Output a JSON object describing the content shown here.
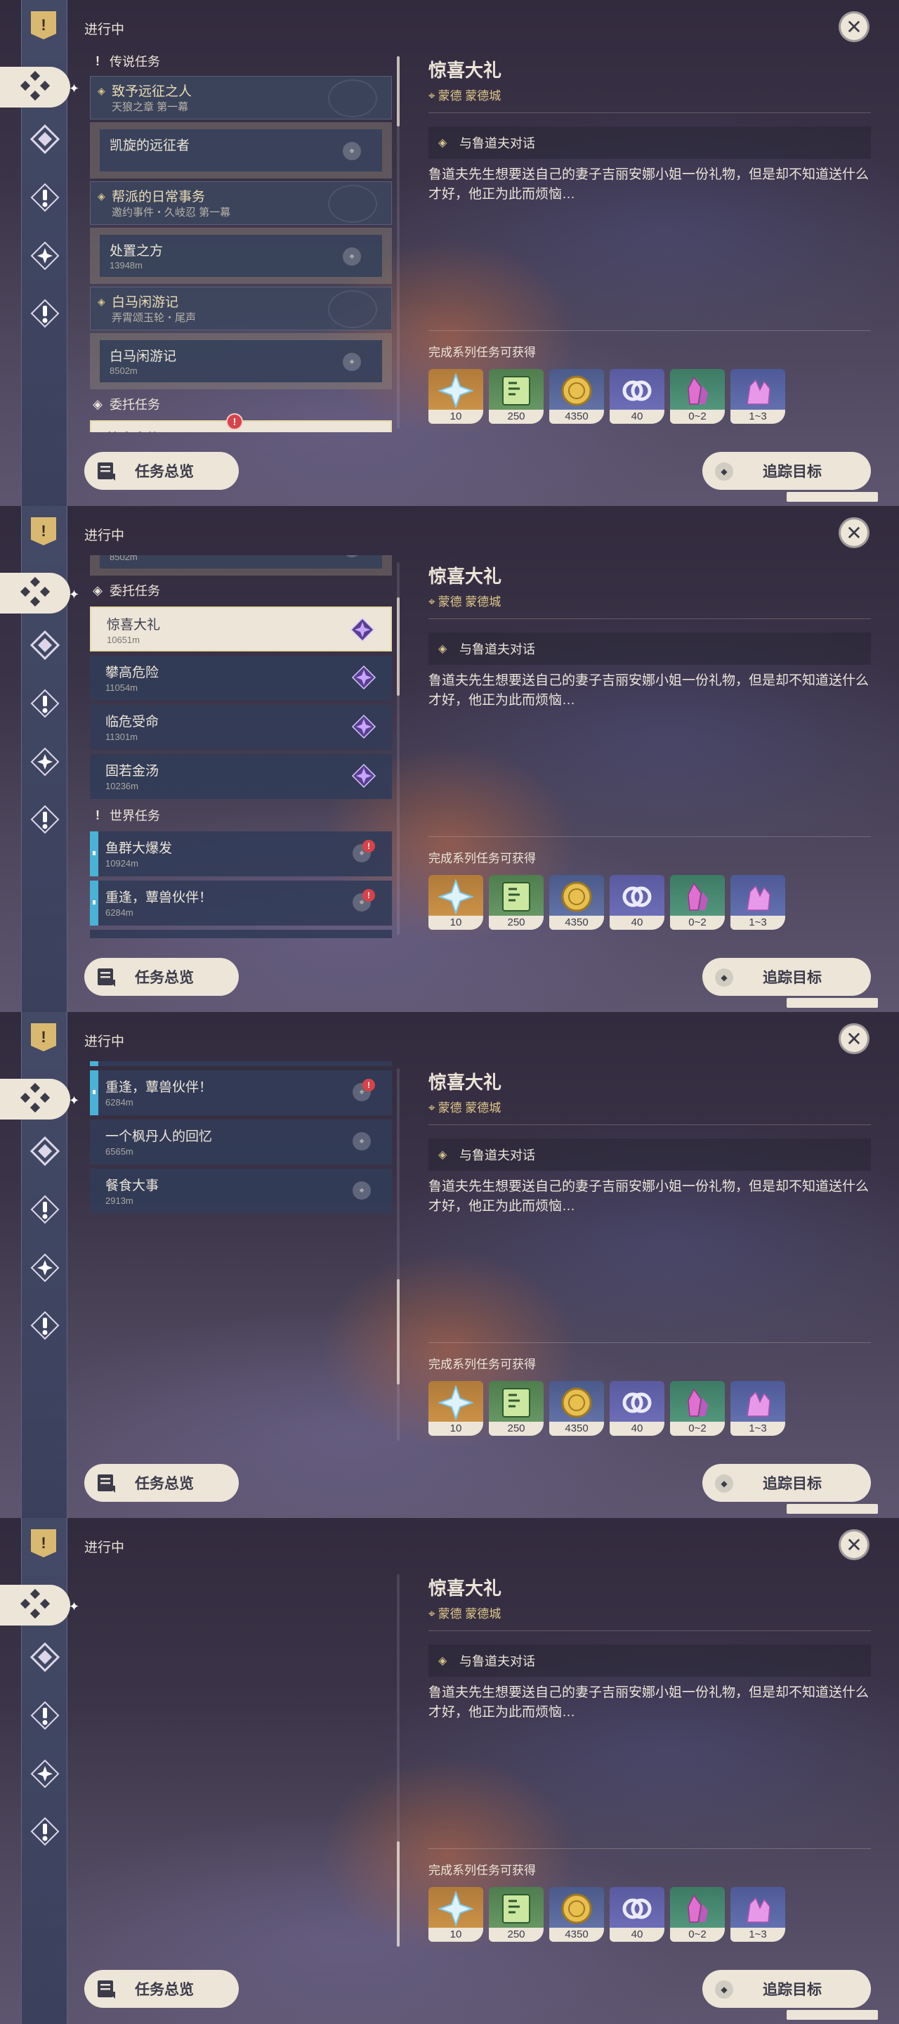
{
  "header": {
    "in_progress": "进行中"
  },
  "categories": {
    "legend": "传说任务",
    "commission": "委托任务",
    "world": "世界任务"
  },
  "groups": {
    "g1": {
      "title": "致予远征之人",
      "sub": "天狼之章 第一幕"
    },
    "g2": {
      "title": "帮派的日常事务",
      "sub": "邀约事件・久岐忍 第一幕"
    },
    "g3": {
      "title": "白马闲游记",
      "sub": "弄霄颂玉轮・尾声"
    }
  },
  "items": {
    "kaixuan": {
      "title": "凯旋的远征者",
      "dist": ""
    },
    "chuzhi": {
      "title": "处置之方",
      "dist": "13948m"
    },
    "baima": {
      "title": "白马闲游记",
      "dist": "8502m"
    },
    "jingxi": {
      "title": "惊喜大礼",
      "dist": "10651m"
    },
    "pangao": {
      "title": "攀高危险",
      "dist": "11054m"
    },
    "linwei": {
      "title": "临危受命",
      "dist": "11301m"
    },
    "guruo": {
      "title": "固若金汤",
      "dist": "10236m"
    },
    "yuqun": {
      "title": "鱼群大爆发",
      "dist": "10924m"
    },
    "chongfeng": {
      "title": "重逢，蕈兽伙伴！",
      "dist": "6284m"
    },
    "fengdan": {
      "title": "一个枫丹人的回忆",
      "dist": "6565m"
    },
    "canshi": {
      "title": "餐食大事",
      "dist": "2913m"
    }
  },
  "detail": {
    "title": "惊喜大礼",
    "location": "蒙德 蒙德城",
    "objective": "与鲁道夫对话",
    "description": "鲁道夫先生想要送自己的妻子吉丽安娜小姐一份礼物，但是却不知道送什么才好，他正为此而烦恼…",
    "rewards_label": "完成系列任务可获得",
    "rewards": [
      {
        "icon": "primogem-icon",
        "count": "10",
        "bg": "#c88a3e"
      },
      {
        "icon": "adventure-exp-icon",
        "count": "250",
        "bg": "#6f9a62"
      },
      {
        "icon": "mora-icon",
        "count": "4350",
        "bg": "#5a6aa0"
      },
      {
        "icon": "companionship-exp-icon",
        "count": "40",
        "bg": "#6a6ab0"
      },
      {
        "icon": "crystal-fragment-icon",
        "count": "0~2",
        "bg": "#4f8a72"
      },
      {
        "icon": "crystal-chunk-icon",
        "count": "1~3",
        "bg": "#5a6aa8"
      }
    ]
  },
  "buttons": {
    "overview": "任务总览",
    "track": "追踪目标"
  },
  "colors": {
    "accent_cream": "#ece5d8",
    "gold": "#d9c48a",
    "alert_red": "#d8424a",
    "world_stripe": "#4ab2d6"
  }
}
